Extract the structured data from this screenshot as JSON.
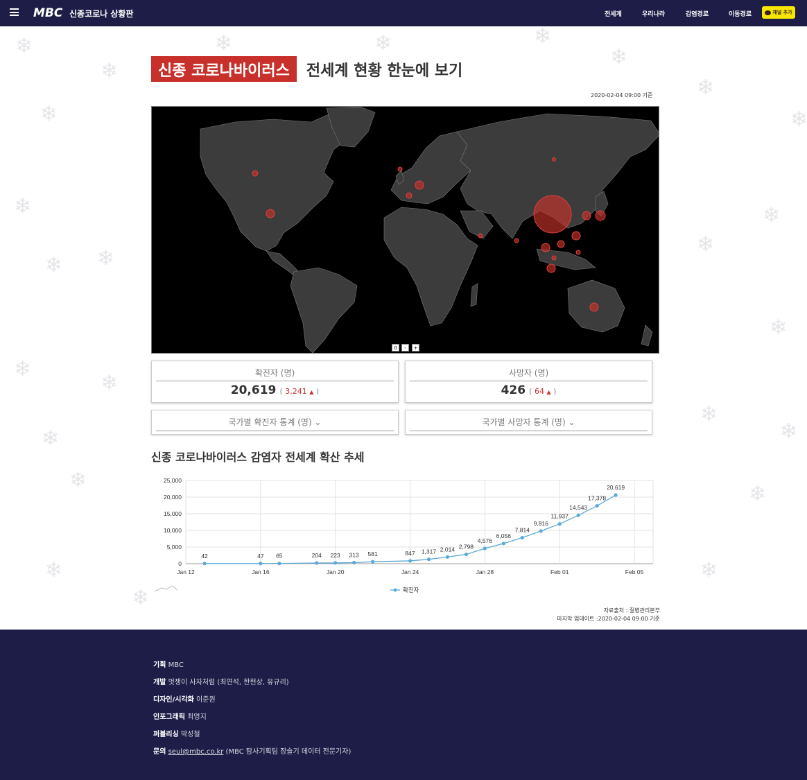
{
  "header": {
    "logo": "MBC",
    "site_title": "신종코로나 상황판",
    "nav": [
      "전세계",
      "우리나라",
      "감염경로",
      "이동경로"
    ],
    "channel_button": "채널 추가"
  },
  "headline": {
    "highlight": "신종 코로나바이러스",
    "rest": "전세계 현황 한눈에 보기"
  },
  "as_of": "2020-02-04 09:00 기준",
  "map": {
    "zoom_reset": "0",
    "zoom_out": "-",
    "zoom_in": "+",
    "bubble_color": "#c8312b",
    "land_color": "#3c3c3c"
  },
  "stats": {
    "confirmed": {
      "label": "확진자 (명)",
      "value": "20,619",
      "delta": "3,241"
    },
    "deaths": {
      "label": "사망자 (명)",
      "value": "426",
      "delta": "64"
    }
  },
  "dropdowns": {
    "confirmed_by_country": "국가별 확진자 통계 (명)",
    "deaths_by_country": "국가별 사망자 통계 (명)"
  },
  "chart_title": "신종 코로나바이러스 감염자 전세계 확산 추세",
  "chart_data": {
    "type": "line",
    "x_tick_labels": [
      "Jan 12",
      "Jan 16",
      "Jan 20",
      "Jan 24",
      "Jan 28",
      "Feb 01",
      "Feb 05"
    ],
    "y_tick_labels": [
      "0",
      "5,000",
      "10,000",
      "15,000",
      "20,000",
      "25,000"
    ],
    "ylim": [
      0,
      25000
    ],
    "grid": true,
    "legend_position": "bottom",
    "color": "#5aa9d6",
    "series": [
      {
        "name": "확진자",
        "points": [
          {
            "x": "2020-01-13",
            "y": 42,
            "label": "42"
          },
          {
            "x": "2020-01-16",
            "y": 47,
            "label": "47"
          },
          {
            "x": "2020-01-17",
            "y": 65,
            "label": "65"
          },
          {
            "x": "2020-01-19",
            "y": 204,
            "label": "204"
          },
          {
            "x": "2020-01-20",
            "y": 223,
            "label": "223"
          },
          {
            "x": "2020-01-21",
            "y": 313,
            "label": "313"
          },
          {
            "x": "2020-01-22",
            "y": 581,
            "label": "581"
          },
          {
            "x": "2020-01-24",
            "y": 847,
            "label": "847"
          },
          {
            "x": "2020-01-25",
            "y": 1317,
            "label": "1,317"
          },
          {
            "x": "2020-01-26",
            "y": 2014,
            "label": "2,014"
          },
          {
            "x": "2020-01-27",
            "y": 2798,
            "label": "2,798"
          },
          {
            "x": "2020-01-28",
            "y": 4576,
            "label": "4,576"
          },
          {
            "x": "2020-01-29",
            "y": 6056,
            "label": "6,056"
          },
          {
            "x": "2020-01-30",
            "y": 7814,
            "label": "7,814"
          },
          {
            "x": "2020-01-31",
            "y": 9816,
            "label": "9,816"
          },
          {
            "x": "2020-02-01",
            "y": 11937,
            "label": "11,937"
          },
          {
            "x": "2020-02-02",
            "y": 14543,
            "label": "14,543"
          },
          {
            "x": "2020-02-03",
            "y": 17378,
            "label": "17,378"
          },
          {
            "x": "2020-02-04",
            "y": 20619,
            "label": "20,619"
          }
        ]
      }
    ]
  },
  "source": {
    "line1": "자료출처 : 질병관리본부",
    "line2": "마지막 업데이트 :2020-02-04 09:00 기준"
  },
  "footer": {
    "rows": [
      {
        "key": "기획",
        "value": "MBC"
      },
      {
        "key": "개발",
        "value": "멋쟁이 사자처럼 (최연석, 한현상, 유규리)"
      },
      {
        "key": "디자인/시각화",
        "value": "이준원"
      },
      {
        "key": "인포그래픽",
        "value": "최영지"
      },
      {
        "key": "퍼블리싱",
        "value": "박성철"
      }
    ],
    "contact_key": "문의",
    "contact_email": "seul@mbc.co.kr",
    "contact_note": "(MBC 탐사기획팀 장슬기 데이터 전문기자)"
  }
}
